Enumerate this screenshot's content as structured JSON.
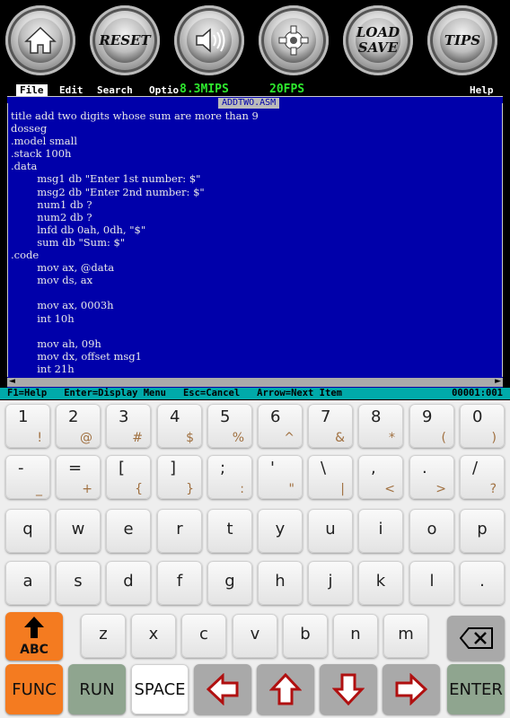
{
  "toolbar": {
    "reset_label": "RESET",
    "load_label": "LOAD",
    "save_label": "SAVE",
    "tips_label": "TIPS"
  },
  "menubar": {
    "file": "File",
    "edit": "Edit",
    "search": "Search",
    "options": "Optio",
    "mips": "8.3MIPS",
    "fps": "20FPS",
    "help": "Help"
  },
  "editor": {
    "filename": "ADDTWO.ASM",
    "code": "title add two digits whose sum are more than 9\ndosseg\n.model small\n.stack 100h\n.data\n        msg1 db \"Enter 1st number: $\"\n        msg2 db \"Enter 2nd number: $\"\n        num1 db ?\n        num2 db ?\n        lnfd db 0ah, 0dh, \"$\"\n        sum db \"Sum: $\"\n.code\n        mov ax, @data\n        mov ds, ax\n\n        mov ax, 0003h\n        int 10h\n\n        mov ah, 09h\n        mov dx, offset msg1\n        int 21h"
  },
  "helpline": {
    "text": "F1=Help   Enter=Display Menu   Esc=Cancel   Arrow=Next Item",
    "position": "00001:001"
  },
  "keyboard": {
    "row1": [
      {
        "main": "1",
        "alt": "!"
      },
      {
        "main": "2",
        "alt": "@"
      },
      {
        "main": "3",
        "alt": "#"
      },
      {
        "main": "4",
        "alt": "$"
      },
      {
        "main": "5",
        "alt": "%"
      },
      {
        "main": "6",
        "alt": "^"
      },
      {
        "main": "7",
        "alt": "&"
      },
      {
        "main": "8",
        "alt": "*"
      },
      {
        "main": "9",
        "alt": "("
      },
      {
        "main": "0",
        "alt": ")"
      }
    ],
    "row2": [
      {
        "main": "-",
        "alt": "_"
      },
      {
        "main": "=",
        "alt": "+"
      },
      {
        "main": "[",
        "alt": "{"
      },
      {
        "main": "]",
        "alt": "}"
      },
      {
        "main": ";",
        "alt": ":"
      },
      {
        "main": "'",
        "alt": "\""
      },
      {
        "main": "\\",
        "alt": "|"
      },
      {
        "main": ",",
        "alt": "<"
      },
      {
        "main": ".",
        "alt": ">"
      },
      {
        "main": "/",
        "alt": "?"
      }
    ],
    "row3": [
      "q",
      "w",
      "e",
      "r",
      "t",
      "y",
      "u",
      "i",
      "o",
      "p"
    ],
    "row4": [
      "a",
      "s",
      "d",
      "f",
      "g",
      "h",
      "j",
      "k",
      "l",
      "."
    ],
    "row5": [
      "z",
      "x",
      "c",
      "v",
      "b",
      "n",
      "m"
    ],
    "abc_label": "ABC",
    "func_label": "FUNC",
    "run_label": "RUN",
    "space_label": "SPACE",
    "enter_label": "ENTER",
    "colors": {
      "orange": "#f47b20",
      "green": "#8fa58f",
      "grey": "#a9a9a9",
      "arrow": "#b01010"
    }
  }
}
